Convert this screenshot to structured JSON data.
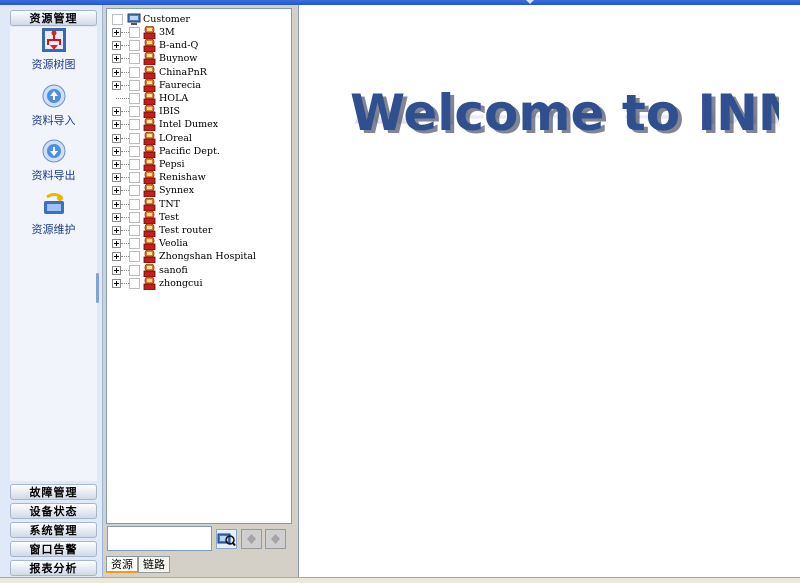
{
  "nav": {
    "header": "资源管理",
    "tools": [
      {
        "label": "资源树图",
        "icon": "resource-tree-icon"
      },
      {
        "label": "资料导入",
        "icon": "import-icon"
      },
      {
        "label": "资料导出",
        "icon": "export-icon"
      },
      {
        "label": "资源维护",
        "icon": "maintenance-icon"
      }
    ],
    "sections": [
      "故障管理",
      "设备状态",
      "系统管理",
      "窗口告警",
      "报表分析"
    ]
  },
  "tree": {
    "root": "Customer",
    "items": [
      "3M",
      "B-and-Q",
      "Buynow",
      "ChinaPnR",
      "Faurecia",
      "HOLA",
      "IBIS",
      "Intel Dumex",
      "LOreal",
      "Pacific Dept.",
      "Pepsi",
      "Renishaw",
      "Synnex",
      "TNT",
      "Test",
      "Test router",
      "Veolia",
      "Zhongshan Hospital",
      "sanofi",
      "zhongcui"
    ],
    "no_expander": [
      "HOLA"
    ]
  },
  "search": {
    "value": ""
  },
  "tabs": [
    "资源",
    "链路"
  ],
  "main": {
    "welcome": "Welcome to INMC"
  },
  "colors": {
    "welcome_text": "#2f4f8f",
    "nav_label": "#1f3b8a",
    "tab_active": "#e89e1b"
  }
}
